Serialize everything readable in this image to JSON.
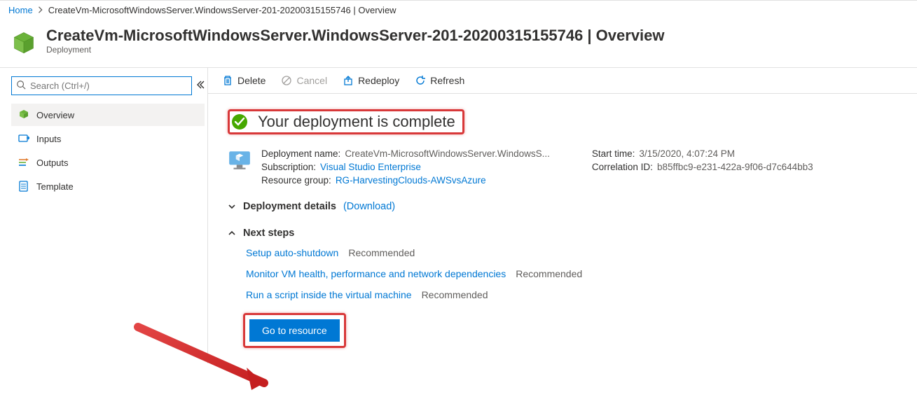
{
  "breadcrumbs": {
    "home": "Home",
    "current": "CreateVm-MicrosoftWindowsServer.WindowsServer-201-20200315155746 | Overview"
  },
  "header": {
    "title": "CreateVm-MicrosoftWindowsServer.WindowsServer-201-20200315155746 | Overview",
    "subtitle": "Deployment"
  },
  "search": {
    "placeholder": "Search (Ctrl+/)"
  },
  "sidebar": {
    "items": [
      {
        "label": "Overview"
      },
      {
        "label": "Inputs"
      },
      {
        "label": "Outputs"
      },
      {
        "label": "Template"
      }
    ]
  },
  "commands": {
    "delete": "Delete",
    "cancel": "Cancel",
    "redeploy": "Redeploy",
    "refresh": "Refresh"
  },
  "status": {
    "message": "Your deployment is complete"
  },
  "details": {
    "deployment_name_label": "Deployment name:",
    "deployment_name": "CreateVm-MicrosoftWindowsServer.WindowsS...",
    "subscription_label": "Subscription:",
    "subscription": "Visual Studio Enterprise",
    "resource_group_label": "Resource group:",
    "resource_group": "RG-HarvestingClouds-AWSvsAzure",
    "start_time_label": "Start time:",
    "start_time": "3/15/2020, 4:07:24 PM",
    "correlation_id_label": "Correlation ID:",
    "correlation_id": "b85ffbc9-e231-422a-9f06-d7c644bb3"
  },
  "sections": {
    "deployment_details": "Deployment details",
    "download": "(Download)",
    "next_steps": "Next steps"
  },
  "next_steps": [
    {
      "text": "Setup auto-shutdown",
      "tag": "Recommended"
    },
    {
      "text": "Monitor VM health, performance and network dependencies",
      "tag": "Recommended"
    },
    {
      "text": "Run a script inside the virtual machine",
      "tag": "Recommended"
    }
  ],
  "go_to_resource": "Go to resource"
}
